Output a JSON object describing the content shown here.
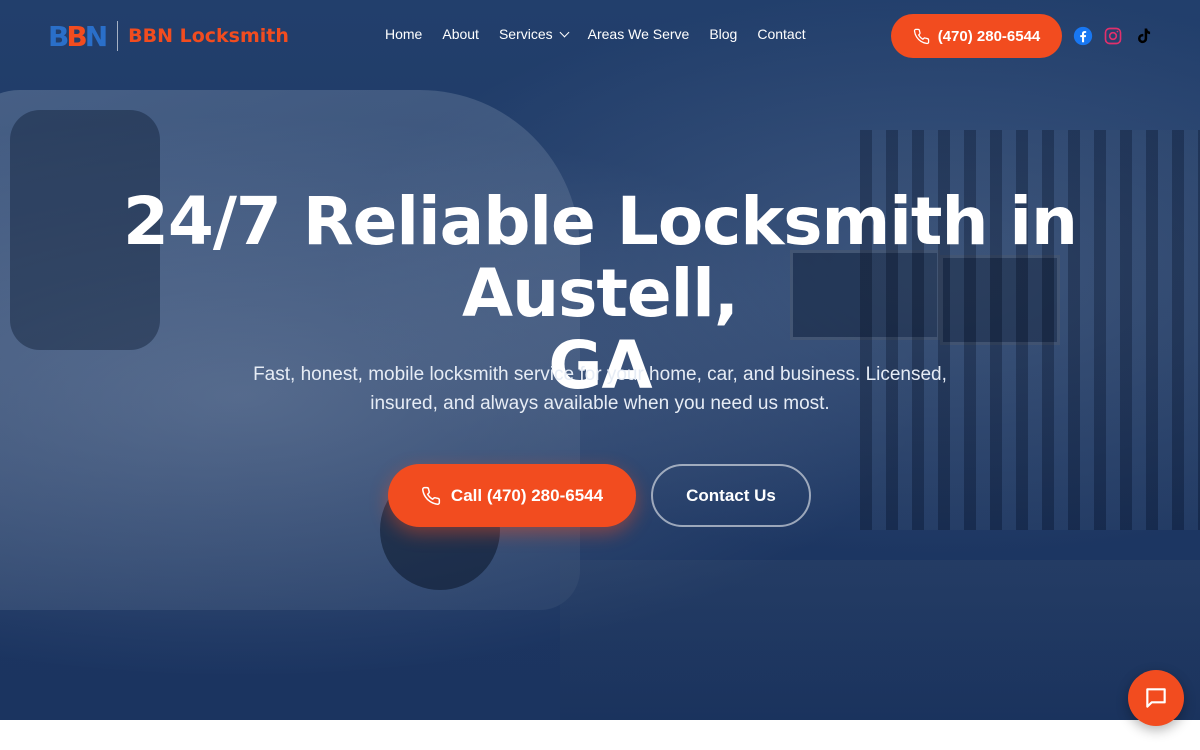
{
  "brand": {
    "mark_b1": "B",
    "mark_b2": "B",
    "mark_n": "N",
    "name": "BBN Locksmith",
    "colors": {
      "primary": "#2a6fc9",
      "accent": "#f24c1f",
      "hero_bg": "#1d3763"
    }
  },
  "nav": {
    "items": [
      {
        "label": "Home"
      },
      {
        "label": "About"
      },
      {
        "label": "Services",
        "has_dropdown": true
      },
      {
        "label": "Areas We Serve"
      },
      {
        "label": "Blog"
      },
      {
        "label": "Contact"
      }
    ]
  },
  "header": {
    "phone_label": "(470) 280-6544",
    "social": [
      {
        "icon": "facebook-icon"
      },
      {
        "icon": "instagram-icon"
      },
      {
        "icon": "tiktok-icon"
      }
    ]
  },
  "hero": {
    "title_line1": "24/7 Reliable Locksmith in Austell,",
    "title_line2": "GA",
    "subtitle": "Fast, honest, mobile locksmith service for your home, car, and business. Licensed, insured, and always available when you need us most.",
    "call_button": "Call (470) 280-6544",
    "contact_button": "Contact Us"
  },
  "chat": {
    "icon": "chat-bubble-icon"
  }
}
